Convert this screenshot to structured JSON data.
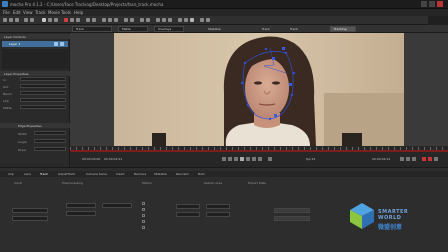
{
  "window": {
    "title": "mocha Pro 4.1.2 - C:/Users/Face Tracking/Desktop/Projects/face_track.mocha"
  },
  "menu": [
    "File",
    "Edit",
    "View",
    "Track",
    "Movie",
    "Tools",
    "Help"
  ],
  "viewer_toolbar": {
    "layer_dropdown": "Track",
    "view_dropdown": "Matte",
    "overlay_dropdown": "Overlays",
    "stab_label": "Stabilize",
    "track_label": "Track",
    "tracking_badge": "Tracking"
  },
  "layer_controls": {
    "header": "Layer Controls",
    "layer_name": "Layer 1"
  },
  "layer_properties": {
    "header": "Layer Properties",
    "rows": [
      "In",
      "Out",
      "Blend",
      "Link",
      "Matte"
    ],
    "edge_header": "Edge Properties",
    "edge_rows": [
      "Width",
      "Angle",
      "Draw"
    ]
  },
  "timeline": {
    "in_tc": "00:00:00:00",
    "current_tc": "00:00:02:21",
    "out_tc": "00:00:06:12",
    "fps": "fps 24"
  },
  "bottom_tabs": [
    "Clip",
    "Lens",
    "Track",
    "AdjustTrack",
    "Camera Solve",
    "Insert",
    "Remove",
    "Stabilize",
    "Reorient",
    "Roto"
  ],
  "bottom_sections": [
    "Input",
    "Preprocessing",
    "Motion",
    "Search Area",
    "Export Data"
  ],
  "branding": {
    "line1": "SMARTER",
    "line2": "WORLD",
    "line3": "微盟创意"
  },
  "colors": {
    "accent_blue": "#3f6f9a",
    "timeline_red": "#7d1e1e",
    "spline_blue": "#2f4fd8"
  }
}
